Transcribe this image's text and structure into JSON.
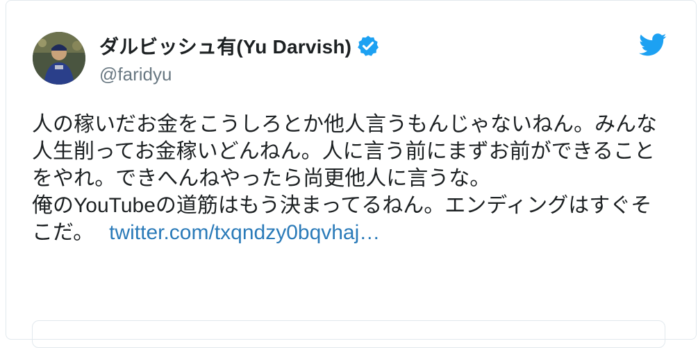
{
  "tweet": {
    "display_name": "ダルビッシュ有(Yu Darvish)",
    "handle": "@faridyu",
    "verified_icon": "verified-badge-icon",
    "brand_icon": "twitter-bird-icon",
    "text": "人の稼いだお金をこうしろとか他人言うもんじゃないねん。みんな人生削ってお金稼いどんねん。人に言う前にまずお前ができることをやれ。できへんねやったら尚更他人に言うな。\n俺のYouTubeの道筋はもう決まってるねん。エンディングはすぐそこだ。",
    "link_text": "twitter.com/txqndzy0bqvhaj…"
  },
  "colors": {
    "link": "#2b7bb9",
    "verified": "#1da1f2",
    "twitter_blue": "#1da1f2",
    "handle_gray": "#697882",
    "border": "#e1e8ed"
  }
}
